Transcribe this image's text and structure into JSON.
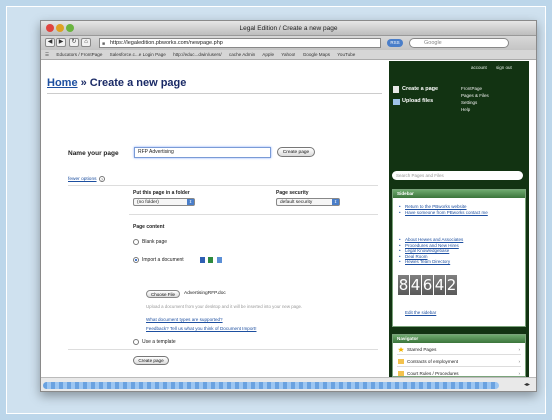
{
  "window": {
    "title": "Legal Edition / Create a new page"
  },
  "toolbar": {
    "url": "https://legaledition.pbworks.com/newpage.php",
    "rss_label": "RSS",
    "search_placeholder": "Google"
  },
  "bookmarks": [
    "Educators / FrontPage",
    "Salesforce.c...e Login Page",
    "http://educ...dwin/users/",
    "cache Admin",
    "Apple",
    "Yahoo!",
    "Google Maps",
    "YouTube"
  ],
  "main": {
    "breadcrumb_home": "Home",
    "breadcrumb_sep": " » ",
    "page_title": "Create a new page",
    "name_label": "Name your page",
    "name_value": "RFP Advertising",
    "create_btn": "Create page",
    "fewer_options": "fewer options",
    "folder_label": "Put this page in a folder",
    "folder_value": "(no folder)",
    "security_label": "Page security",
    "security_value": "default security",
    "content_label": "Page content",
    "opt_blank": "Blank page",
    "opt_import": "Import a document",
    "choose_file": "Choose File",
    "file_name": "AdvertisingRFP.doc",
    "help_text": "Upload a document from your desktop and it will be inserted into your new page.",
    "link_supported": "What document types are supported?",
    "link_feedback": "Feedback? Tell us what you think of Document Import!",
    "opt_template": "Use a template",
    "create_btn_bottom": "Create page"
  },
  "sidebar": {
    "account": "account",
    "signout": "sign out",
    "create_page": "Create a page",
    "upload_files": "Upload files",
    "links": [
      "FrontPage",
      "Pages & Files",
      "Settings",
      "Help"
    ],
    "search_placeholder": "Search Pages and Files",
    "sidebar_heading": "Sidebar",
    "list1": [
      "Return to the PBworks website",
      "Have someone from PBworks contact me"
    ],
    "list2": [
      "About Hewes and Associates",
      "Procedures and New Hires",
      "Legal Knowledgebase",
      "Deal Room",
      "Hewes Team Directory"
    ],
    "counter_digits": [
      "8",
      "4",
      "6",
      "4",
      "2"
    ],
    "edit_sidebar": "Edit the sidebar",
    "navigator_heading": "Navigator",
    "nav_items": [
      "Starred Pages",
      "Contracts of employment",
      "Court Rules / Procedures"
    ]
  },
  "colors": {
    "accent": "#1d4fa0",
    "sidebar_bg": "#123312",
    "panel_head": "#3b753b"
  }
}
